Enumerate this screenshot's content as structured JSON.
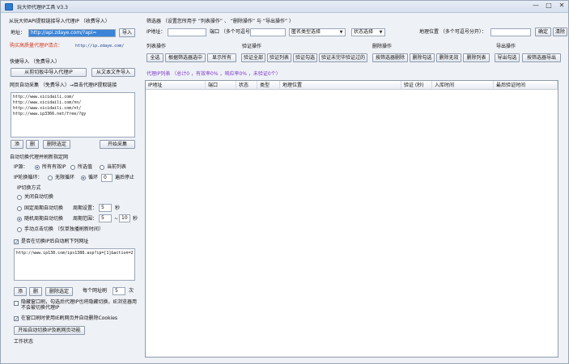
{
  "title": "玩大师代理IP工具 V3.3",
  "window_buttons": {
    "minimize": "—",
    "maximize": "□",
    "close": "✕"
  },
  "left": {
    "api_section_title": "从玩大师API提取链接导入代理IP （收费导入）",
    "url_label": "地址：",
    "url_value": "http://api.zdaye.com/?api=",
    "import_button": "导入",
    "buy_link_text": "购买高质量代理IP请点：",
    "buy_link_url": "http://ip.zdaye.com/",
    "quick_import_title": "快捷导入 （免费导入）",
    "clipboard_button": "从剪切板中导入代理IP",
    "file_button": "从文本文件导入",
    "web_extract_title": "网页自动采集 （免费导入）→目击代理IP提取链接",
    "web_urls": "http://www.xicidaili.com/\nhttp://www.xicidaili.com/nn/\nhttp://www.xicidaili.com/nt/\nhttp://www.ip3366.net/free/?gy",
    "small_btn_add": "添",
    "small_btn_del": "删",
    "delete_selected_button": "删除选定",
    "start_collect_button": "开始采集",
    "auto_switch_title": "自动切换代理并刷新指定网",
    "ip_source_label": "IP源：",
    "ip_source_options": [
      "所有有效IP",
      "所选值",
      "当前列表"
    ],
    "ip_loop_label": "IP轮换循环：",
    "loop_options": [
      "无限循环",
      "循环"
    ],
    "loop_count": "0",
    "loop_suffix": "遍后停止",
    "switch_mode_label": "IP切换方式",
    "switch_modes": [
      "关闭自动切换",
      "固定周期自动切换",
      "随机周期自动切换",
      "手动点击切换 （仅单独播刷新时间）"
    ],
    "fixed_period_label": "周期设置：",
    "fixed_period_value": "5",
    "fixed_period_unit": "秒",
    "random_period_label": "周期范围：",
    "random_from": "5",
    "random_to": "10",
    "random_unit": "秒",
    "open_page_check_label": "是否在切换IP后自动刷下列网址",
    "refresh_url": "http://www.ip138.com/ips1388.asp?ip=[1]&action=2",
    "per_page_label": "每个网址刷",
    "per_page_value": "5",
    "per_page_unit": "次",
    "option1": "隐藏窗口刷，勾选后代理IP也将隐藏切换，IE浏览器用不会被切换代理IP",
    "option2": "在窗口刷时使用IE刷网页并自动删除Cookies",
    "start_switch_button": "开始自动切换IP及刷网页功能",
    "status_label": "工作状态"
  },
  "right": {
    "filter_title": "筛选器 （设置您所用于 “列表操作” 、 “删除操作” 与 “导出操作” ）",
    "ip_label": "IP地址：",
    "port_label": "端口 （多个可逗号分开）：",
    "anon_select": "匿名类型选择",
    "status_select": "状态选择",
    "location_label": "地理位置 （多个可逗号分开）：",
    "confirm_button": "确定",
    "clear_button": "清除",
    "list_ops_title": "列表操作",
    "list_ops_buttons": [
      "全选",
      "根据筛选器选中",
      "显示所有"
    ],
    "verify_ops_title": "验证操作",
    "verify_ops_buttons": [
      "验证全部",
      "验证列表",
      "验证勾选",
      "验证未完毕验证过的"
    ],
    "delete_ops_title": "删除操作",
    "delete_ops_buttons": [
      "按筛选器删除",
      "删除勾选",
      "删除无效",
      "删除列表"
    ],
    "export_ops_title": "导出操作",
    "export_ops_buttons": [
      "导出勾选",
      "按筛选器导出"
    ],
    "stats_text": "代理IP列表 （总计0 ，有效率0% ，响应率0% ，未验证0个）",
    "columns": [
      "IP地址",
      "端口",
      "状态",
      "类型",
      "地理位置",
      "验证 (秒)",
      "入库时间",
      "最后验证时间"
    ]
  }
}
